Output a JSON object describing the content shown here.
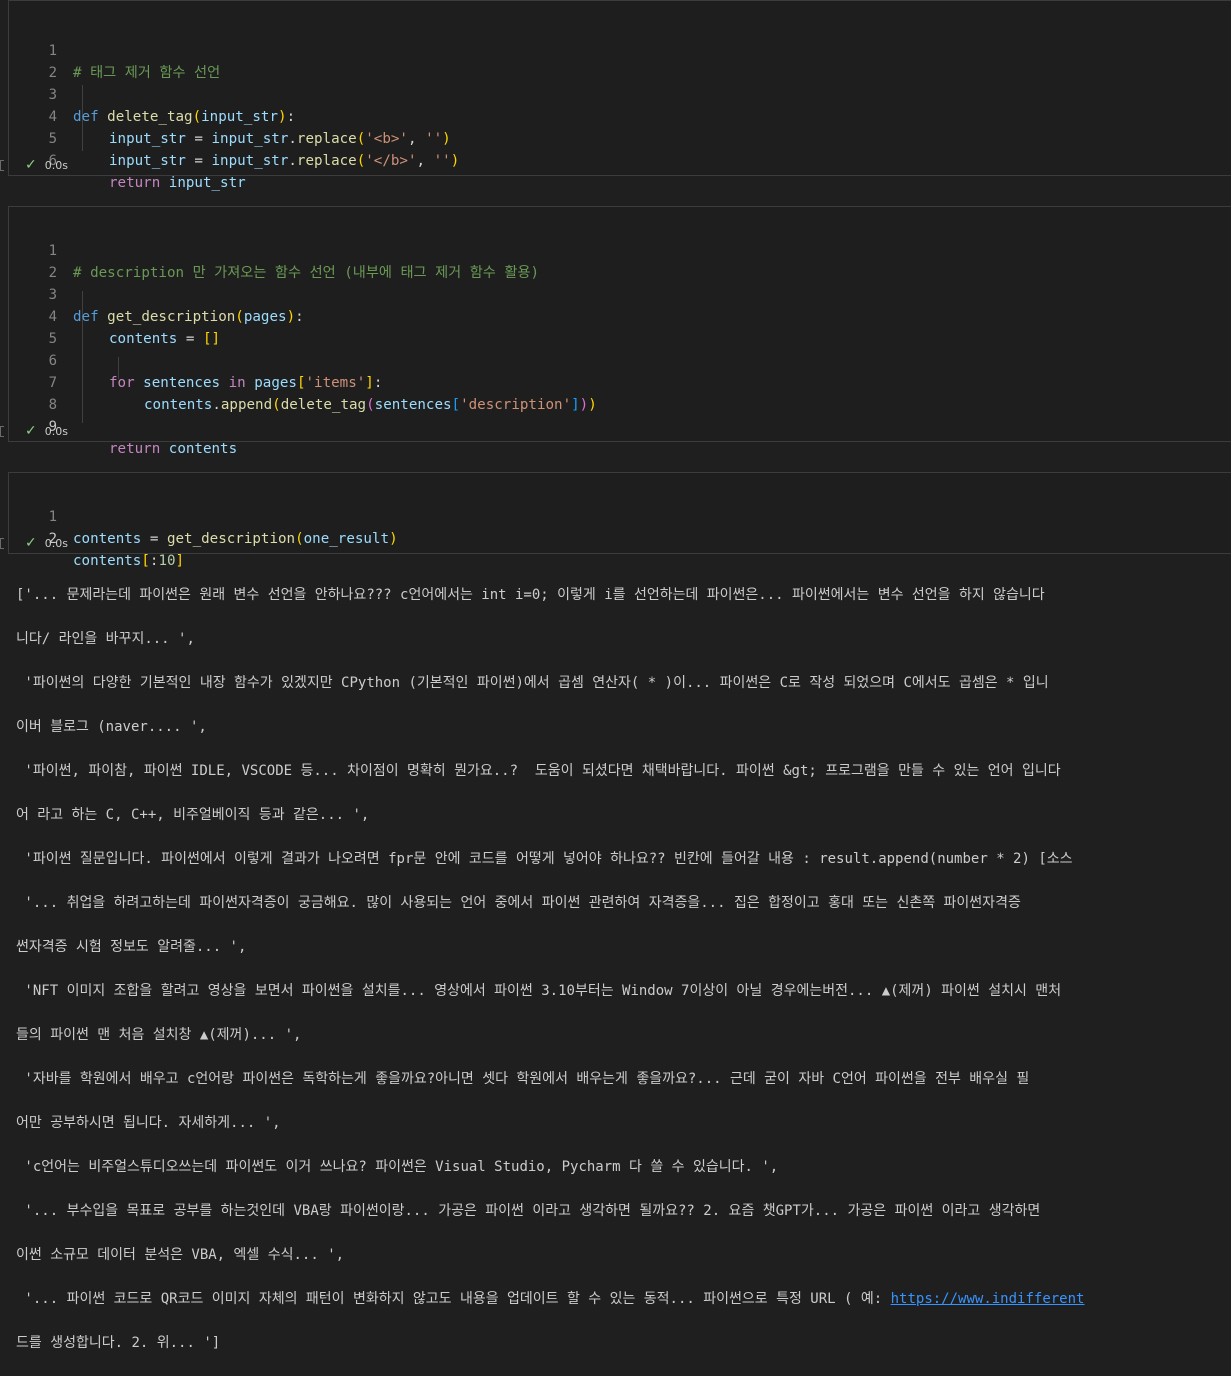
{
  "cells": [
    {
      "line_numbers": [
        "1",
        "2",
        "3",
        "4",
        "5",
        "6"
      ],
      "lines": {
        "l1": "# 태그 제거 함수 선언",
        "l3_kw": "def",
        "l3_fn": "delete_tag",
        "l3_p1": "(",
        "l3_arg": "input_str",
        "l3_p2": ")",
        "l3_colon": ":",
        "l4_var": "input_str",
        "l4_eq": " = ",
        "l4_obj": "input_str",
        "l4_dot": ".",
        "l4_fn": "replace",
        "l4_p1": "(",
        "l4_s1": "'<b>'",
        "l4_c": ", ",
        "l4_s2": "''",
        "l4_p2": ")",
        "l5_var": "input_str",
        "l5_eq": " = ",
        "l5_obj": "input_str",
        "l5_dot": ".",
        "l5_fn": "replace",
        "l5_p1": "(",
        "l5_s1": "'</b>'",
        "l5_c": ", ",
        "l5_s2": "''",
        "l5_p2": ")",
        "l6_kw": "return",
        "l6_var": "input_str"
      },
      "status": "0.0s"
    },
    {
      "line_numbers": [
        "1",
        "2",
        "3",
        "4",
        "5",
        "6",
        "7",
        "8",
        "9"
      ],
      "lines": {
        "l1": "# description 만 가져오는 함수 선언 (내부에 태그 제거 함수 활용)",
        "l3_kw": "def",
        "l3_fn": "get_description",
        "l3_p1": "(",
        "l3_arg": "pages",
        "l3_p2": ")",
        "l3_colon": ":",
        "l4_var": "contents",
        "l4_eq": " = ",
        "l4_br": "[]",
        "l6_kw": "for",
        "l6_var": "sentences",
        "l6_in": "in",
        "l6_obj": "pages",
        "l6_b1": "[",
        "l6_s": "'items'",
        "l6_b2": "]",
        "l6_colon": ":",
        "l7_obj": "contents",
        "l7_dot": ".",
        "l7_fn": "append",
        "l7_p1": "(",
        "l7_fn2": "delete_tag",
        "l7_p2": "(",
        "l7_var": "sentences",
        "l7_b1": "[",
        "l7_s": "'description'",
        "l7_b2": "]",
        "l7_p3": ")",
        "l7_p4": ")",
        "l9_kw": "return",
        "l9_var": "contents"
      },
      "status": "0.0s"
    },
    {
      "line_numbers": [
        "1",
        "2"
      ],
      "lines": {
        "l1_var": "contents",
        "l1_eq": " = ",
        "l1_fn": "get_description",
        "l1_p1": "(",
        "l1_arg": "one_result",
        "l1_p2": ")",
        "l2_var": "contents",
        "l2_b1": "[",
        "l2_op": ":",
        "l2_num": "10",
        "l2_b2": "]"
      },
      "status": "0.0s"
    }
  ],
  "output_lines": [
    "['... 문제라는데 파이썬은 원래 변수 선언을 안하나요??? c언어에서는 int i=0; 이렇게 i를 선언하는데 파이썬은... 파이썬에서는 변수 선언을 하지 않습니다",
    "니다/ 라인을 바꾸지... ',",
    " '파이썬의 다양한 기본적인 내장 함수가 있겠지만 CPython (기본적인 파이썬)에서 곱셈 연산자( * )이... 파이썬은 C로 작성 되었으며 C에서도 곱셈은 * 입니",
    "이버 블로그 (naver.... ',",
    " '파이썬, 파이참, 파이썬 IDLE, VSCODE 등... 차이점이 명확히 뭔가요..?  도움이 되셨다면 채택바랍니다. 파이썬 &gt; 프로그램을 만들 수 있는 언어 입니다",
    "어 라고 하는 C, C++, 비주얼베이직 등과 같은... ',",
    " '파이썬 질문입니다. 파이썬에서 이렇게 결과가 나오려면 fpr문 안에 코드를 어떻게 넣어야 하나요?? 빈칸에 들어갈 내용 : result.append(number * 2) [소스",
    " '... 취업을 하려고하는데 파이썬자격증이 궁금해요. 많이 사용되는 언어 중에서 파이썬 관련하여 자격증을... 집은 합정이고 홍대 또는 신촌쪽 파이썬자격증",
    "썬자격증 시험 정보도 알려줄... ',",
    " 'NFT 이미지 조합을 할려고 영상을 보면서 파이썬을 설치를... 영상에서 파이썬 3.10부터는 Window 7이상이 아닐 경우에는버전... ▲(제꺼) 파이썬 설치시 맨처",
    "들의 파이썬 맨 처음 설치창 ▲(제꺼)... ',",
    " '자바를 학원에서 배우고 c언어랑 파이썬은 독학하는게 좋을까요?아니면 셋다 학원에서 배우는게 좋을까요?... 근데 굳이 자바 C언어 파이썬을 전부 배우실 필",
    "어만 공부하시면 됩니다. 자세하게... ',",
    " 'c언어는 비주얼스튜디오쓰는데 파이썬도 이거 쓰나요? 파이썬은 Visual Studio, Pycharm 다 쓸 수 있습니다. ',",
    " '... 부수입을 목표로 공부를 하는것인데 VBA랑 파이썬이랑... 가공은 파이썬 이라고 생각하면 될까요?? 2. 요즘 챗GPT가... 가공은 파이썬 이라고 생각하면",
    "이썬 소규모 데이터 분석은 VBA, 엑셀 수식... ',",
    " '... 파이썬 코드로 QR코드 이미지 자체의 패턴이 변화하지 않고도 내용을 업데이트 할 수 있는 동적... 파이썬으로 특정 URL ( 예: ",
    "드를 생성합니다. 2. 위... ']"
  ],
  "output_link": "https://www.indifferent"
}
